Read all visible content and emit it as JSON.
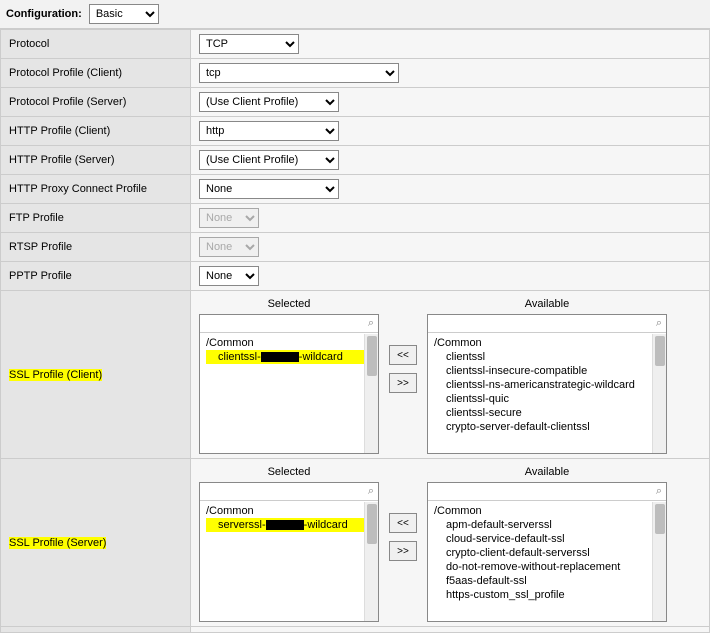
{
  "header": {
    "label": "Configuration:",
    "select_value": "Basic"
  },
  "rows": {
    "protocol": {
      "label": "Protocol",
      "value": "TCP"
    },
    "protocol_profile_client": {
      "label": "Protocol Profile (Client)",
      "value": "tcp"
    },
    "protocol_profile_server": {
      "label": "Protocol Profile (Server)",
      "value": "(Use Client Profile)"
    },
    "http_profile_client": {
      "label": "HTTP Profile (Client)",
      "value": "http"
    },
    "http_profile_server": {
      "label": "HTTP Profile (Server)",
      "value": "(Use Client Profile)"
    },
    "http_proxy_connect": {
      "label": "HTTP Proxy Connect Profile",
      "value": "None"
    },
    "ftp_profile": {
      "label": "FTP Profile",
      "value": "None"
    },
    "rtsp_profile": {
      "label": "RTSP Profile",
      "value": "None"
    },
    "pptp_profile": {
      "label": "PPTP Profile",
      "value": "None"
    },
    "ssl_client": {
      "label": "SSL Profile (Client)",
      "selected_title": "Selected",
      "available_title": "Available",
      "group": "/Common",
      "selected_items": {
        "prefix": "clientssl-",
        "suffix": "-wildcard"
      },
      "available_items": [
        "clientssl",
        "clientssl-insecure-compatible",
        "clientssl-ns-americanstrategic-wildcard",
        "clientssl-quic",
        "clientssl-secure",
        "crypto-server-default-clientssl"
      ],
      "btn_left": "<<",
      "btn_right": ">>"
    },
    "ssl_server": {
      "label": "SSL Profile (Server)",
      "selected_title": "Selected",
      "available_title": "Available",
      "group": "/Common",
      "selected_items": {
        "prefix": "serverssl-",
        "suffix": "-wildcard"
      },
      "available_items": [
        "apm-default-serverssl",
        "cloud-service-default-ssl",
        "crypto-client-default-serverssl",
        "do-not-remove-without-replacement",
        "f5aas-default-ssl",
        "https-custom_ssl_profile"
      ],
      "btn_left": "<<",
      "btn_right": ">>"
    }
  }
}
